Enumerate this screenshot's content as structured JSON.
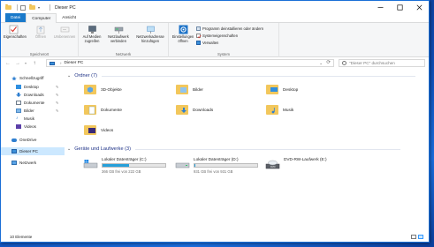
{
  "window": {
    "title": "Dieser PC"
  },
  "ribbon_tabs": [
    "Datei",
    "Computer",
    "Ansicht"
  ],
  "ribbon": {
    "location_group": {
      "label": "Speicherort",
      "buttons": [
        "Eigenschaften",
        "Öffnen",
        "Umbenennen"
      ]
    },
    "network_group": {
      "label": "Netzwerk",
      "buttons": [
        [
          "Auf Medien",
          "zugreifen"
        ],
        [
          "Netzlaufwerk",
          "verbinden"
        ],
        [
          "Netzwerkadresse",
          "hinzufügen"
        ]
      ]
    },
    "system_group": {
      "label": "System",
      "settings_button": [
        "Einstellungen",
        "öffnen"
      ],
      "items": [
        "Programm deinstallieren oder ändern",
        "Systemeigenschaften",
        "Verwalten"
      ]
    }
  },
  "address": {
    "location": "Dieser PC",
    "search_placeholder": "\"Dieser PC\" durchsuchen"
  },
  "nav_pane": {
    "quick_access": "Schnellzugriff",
    "quick_items": [
      "Desktop",
      "Downloads",
      "Dokumente",
      "Bilder",
      "Musik",
      "Videos"
    ],
    "onedrive": "OneDrive",
    "this_pc": "Dieser PC",
    "network": "Netzwerk"
  },
  "content": {
    "folders_header": "Ordner (7)",
    "folders": [
      "3D-Objekte",
      "Bilder",
      "Desktop",
      "Dokumente",
      "Downloads",
      "Musik",
      "Videos"
    ],
    "drives_header": "Geräte und Laufwerke (3)",
    "drives": [
      {
        "name": "Lokaler Datenträger (C:)",
        "free": "366 GB frei von 222 GB",
        "used_fraction": 0.42
      },
      {
        "name": "Lokaler Datenträger (D:)",
        "free": "931 GB frei von 931 GB",
        "used_fraction": 0.01
      },
      {
        "name": "DVD-RW-Laufwerk (E:)"
      }
    ]
  },
  "status": {
    "item_count": "10 Elemente"
  },
  "colors": {
    "accent": "#1979ca",
    "selection": "#cce8ff",
    "folder": "#f2c75c",
    "drive_bar": "#26a0da"
  }
}
